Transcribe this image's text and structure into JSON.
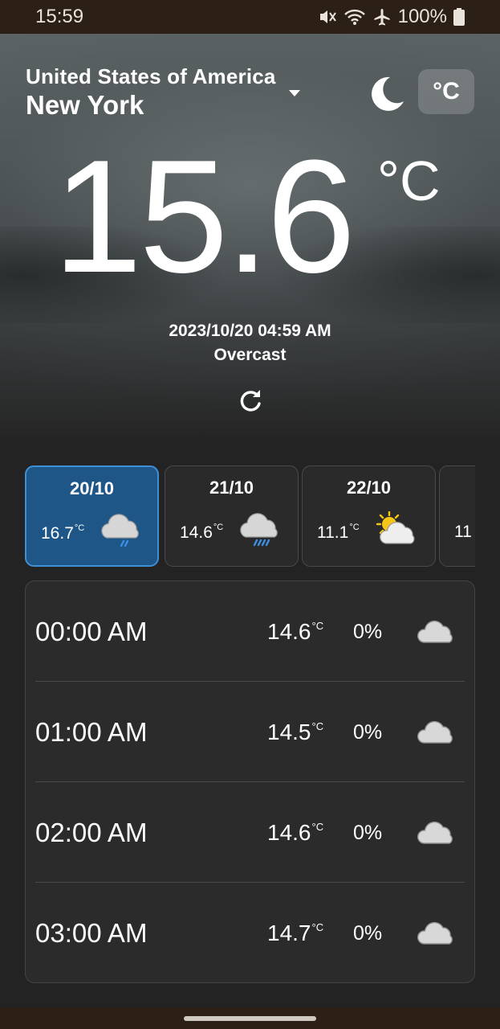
{
  "status_bar": {
    "time": "15:59",
    "battery": "100%",
    "icons": [
      "mute-icon",
      "wifi-icon",
      "airplane-icon",
      "battery-icon"
    ]
  },
  "location": {
    "country": "United States of America",
    "city": "New York"
  },
  "theme_icon": "moon-icon",
  "unit_toggle": "°C",
  "current": {
    "temperature": "15.6",
    "unit": "°C",
    "datetime": "2023/10/20 04:59 AM",
    "condition": "Overcast"
  },
  "days": [
    {
      "date": "20/10",
      "temp": "16.7",
      "unit": "°C",
      "icon": "light-rain-icon",
      "active": true
    },
    {
      "date": "21/10",
      "temp": "14.6",
      "unit": "°C",
      "icon": "rain-icon",
      "active": false
    },
    {
      "date": "22/10",
      "temp": "11.1",
      "unit": "°C",
      "icon": "partly-sunny-icon",
      "active": false
    },
    {
      "date": "",
      "temp": "11",
      "unit": "",
      "icon": "",
      "active": false
    }
  ],
  "hourly": [
    {
      "time": "00:00 AM",
      "temp": "14.6",
      "unit": "°C",
      "precip": "0%",
      "icon": "cloud-icon"
    },
    {
      "time": "01:00 AM",
      "temp": "14.5",
      "unit": "°C",
      "precip": "0%",
      "icon": "cloud-icon"
    },
    {
      "time": "02:00 AM",
      "temp": "14.6",
      "unit": "°C",
      "precip": "0%",
      "icon": "cloud-icon"
    },
    {
      "time": "03:00 AM",
      "temp": "14.7",
      "unit": "°C",
      "precip": "0%",
      "icon": "cloud-icon"
    }
  ],
  "colors": {
    "active_card": "#1f5688",
    "active_border": "#3f8fd6",
    "background": "#232323",
    "rain": "#3d8fe6",
    "sun": "#f5c518"
  }
}
